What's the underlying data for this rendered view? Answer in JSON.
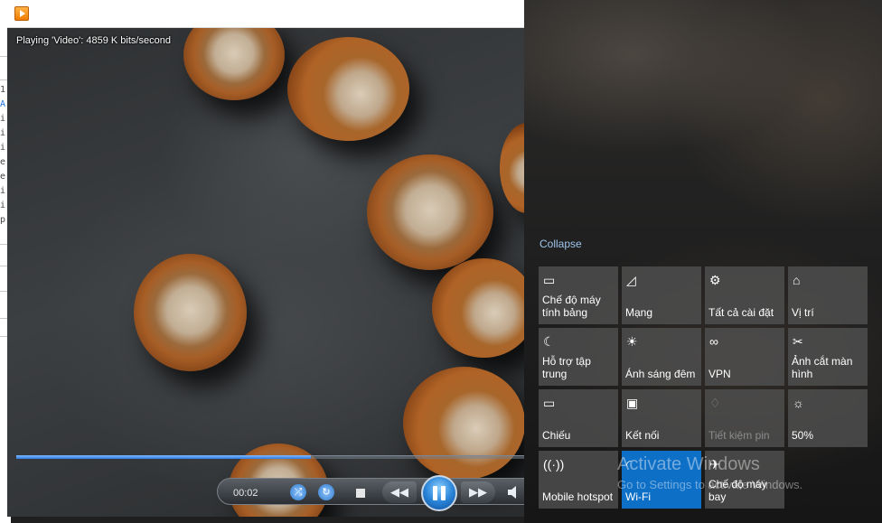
{
  "background_editor": {
    "lines": [
      "1",
      "A",
      "i",
      "i",
      "i",
      "e",
      "e",
      "i",
      "i",
      "p"
    ]
  },
  "player": {
    "app_icon": "media-player-icon",
    "status_text": "Playing 'Video': 4859 K bits/second",
    "elapsed_time": "00:02",
    "seek_progress": 0.58,
    "icons": {
      "shuffle": "shuffle-icon",
      "repeat": "repeat-icon",
      "stop": "stop-icon",
      "previous": "previous-icon",
      "pause": "pause-icon",
      "next": "next-icon",
      "volume": "volume-icon"
    }
  },
  "action_center": {
    "collapse_label": "Collapse",
    "tiles": [
      {
        "label": "Chế độ máy tính bảng",
        "icon": "tablet-mode-icon"
      },
      {
        "label": "Mạng",
        "icon": "network-icon"
      },
      {
        "label": "Tất cả cài đặt",
        "icon": "settings-icon"
      },
      {
        "label": "Vị trí",
        "icon": "location-icon"
      },
      {
        "label": "Hỗ trợ tập trung",
        "icon": "focus-assist-moon-icon"
      },
      {
        "label": "Ánh sáng đêm",
        "icon": "night-light-icon"
      },
      {
        "label": "VPN",
        "icon": "vpn-icon"
      },
      {
        "label": "Ảnh cắt màn hình",
        "icon": "screen-snip-icon"
      },
      {
        "label": "Chiếu",
        "icon": "project-icon"
      },
      {
        "label": "Kết nối",
        "icon": "connect-icon"
      },
      {
        "label": "Tiết kiệm pin",
        "icon": "battery-saver-icon"
      },
      {
        "label": "50%",
        "icon": "brightness-icon"
      },
      {
        "label": "Mobile hotspot",
        "icon": "mobile-hotspot-icon"
      },
      {
        "label": "Wi-Fi",
        "icon": "wifi-icon",
        "active": true
      },
      {
        "label": "Chế độ máy bay",
        "icon": "airplane-icon"
      }
    ]
  },
  "watermark": {
    "line1": "Activate Windows",
    "line2": "Go to Settings to activate Windows."
  },
  "colors": {
    "accent": "#0e6fc6",
    "tile": "#525252",
    "link": "#9ec5ec"
  }
}
